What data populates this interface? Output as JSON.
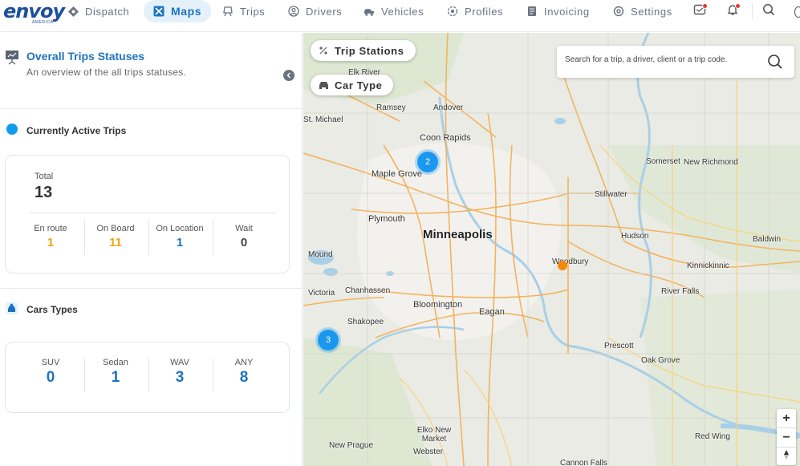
{
  "app": {
    "logo": "envoy",
    "logo_sub": "AMERICA"
  },
  "nav": {
    "items": [
      {
        "label": "Dispatch",
        "icon": "dispatch-icon",
        "active": false
      },
      {
        "label": "Maps",
        "icon": "maps-icon",
        "active": true
      },
      {
        "label": "Trips",
        "icon": "trips-icon",
        "active": false
      },
      {
        "label": "Drivers",
        "icon": "drivers-icon",
        "active": false
      },
      {
        "label": "Vehicles",
        "icon": "vehicles-icon",
        "active": false
      },
      {
        "label": "Profiles",
        "icon": "profiles-icon",
        "active": false
      },
      {
        "label": "Invoicing",
        "icon": "invoicing-icon",
        "active": false
      },
      {
        "label": "Settings",
        "icon": "settings-icon",
        "active": false
      }
    ],
    "icons": [
      "inbox-icon",
      "bell-icon",
      "search-icon"
    ]
  },
  "sidebar": {
    "title": "Overall Trips Statuses",
    "subtitle": "An overview of the all trips statuses.",
    "active_trips": {
      "title": "Currently Active Trips",
      "total_label": "Total",
      "total_value": "13",
      "stats": [
        {
          "label": "En route",
          "value": "1",
          "color": "#f2a40f"
        },
        {
          "label": "On Board",
          "value": "11",
          "color": "#f2a40f"
        },
        {
          "label": "On Location",
          "value": "1",
          "color": "#1e73be"
        },
        {
          "label": "Wait",
          "value": "0",
          "color": "#444444"
        }
      ]
    },
    "car_types": {
      "title": "Cars Types",
      "stats": [
        {
          "label": "SUV",
          "value": "0"
        },
        {
          "label": "Sedan",
          "value": "1"
        },
        {
          "label": "WAV",
          "value": "3"
        },
        {
          "label": "ANY",
          "value": "8"
        }
      ]
    }
  },
  "map": {
    "trip_stations_label": "Trip Stations",
    "car_type_label": "Car Type",
    "search_placeholder": "Search for a trip, a driver, client or a trip code.",
    "clusters": [
      {
        "count": "2"
      },
      {
        "count": "3"
      }
    ],
    "places": {
      "Ramsey": "Ramsey",
      "Andover": "Andover",
      "Elk River": "Elk River",
      "St. Michael": "St. Michael",
      "Coon Rapids": "Coon Rapids",
      "Maple Grove": "Maple Grove",
      "Plymouth": "Plymouth",
      "Minneapolis": "Minneapolis",
      "Mound": "Mound",
      "Victoria": "Victoria",
      "Chanhassen": "Chanhassen",
      "Bloomington": "Bloomington",
      "Eagan": "Eagan",
      "Shakopee": "Shakopee",
      "Stillwater": "Stillwater",
      "Somerset": "Somerset",
      "New Richmond": "New Richmond",
      "Hudson": "Hudson",
      "Baldwin": "Baldwin",
      "Woodbury": "Woodbury",
      "Kinnickinnic": "Kinnickinnic",
      "River Falls": "River Falls",
      "Prescott": "Prescott",
      "Oak Grove": "Oak Grove",
      "Red Wing": "Red Wing",
      "Elko New Market": "Elko New Market",
      "New Prague": "New Prague",
      "Webster": "Webster",
      "Cannon Falls": "Cannon Falls"
    },
    "zoom_in": "+",
    "zoom_out": "−"
  },
  "colors": {
    "accent": "#1e73be",
    "cluster": "#1a98f0",
    "marker": "#f5890b"
  }
}
